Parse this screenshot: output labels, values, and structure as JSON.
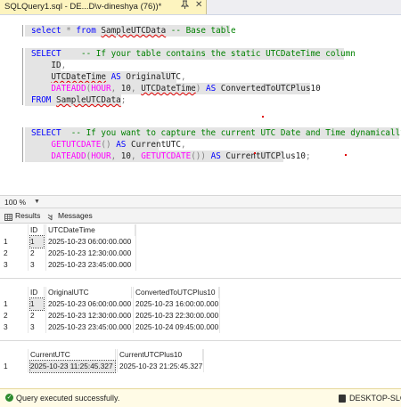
{
  "tab": {
    "title": "SQLQuery1.sql - DE...D\\v-dineshya (76))*",
    "pin_icon": "pin-icon",
    "close_glyph": "✕"
  },
  "editor": {
    "lines": [
      [
        {
          "t": "select",
          "c": "kw"
        },
        {
          "t": " ",
          "c": ""
        },
        {
          "t": "*",
          "c": "gr"
        },
        {
          "t": " ",
          "c": ""
        },
        {
          "t": "from",
          "c": "kw"
        },
        {
          "t": " ",
          "c": ""
        },
        {
          "t": "SampleUTCData",
          "c": "id-err"
        },
        {
          "t": " -- Base table",
          "c": "cm"
        }
      ],
      [],
      [
        {
          "t": "SELECT",
          "c": "kw"
        },
        {
          "t": "    -- If your table contains the static UTCDateTime column",
          "c": "cm"
        }
      ],
      [
        {
          "t": "    ID",
          "c": ""
        },
        {
          "t": ",",
          "c": "gr"
        }
      ],
      [
        {
          "t": "    ",
          "c": ""
        },
        {
          "t": "UTCDateTime",
          "c": "id-err"
        },
        {
          "t": " ",
          "c": ""
        },
        {
          "t": "AS",
          "c": "kw"
        },
        {
          "t": " OriginalUTC",
          "c": ""
        },
        {
          "t": ",",
          "c": "gr"
        }
      ],
      [
        {
          "t": "    ",
          "c": ""
        },
        {
          "t": "DATEADD",
          "c": "fn"
        },
        {
          "t": "(",
          "c": "gr"
        },
        {
          "t": "HOUR",
          "c": "fn"
        },
        {
          "t": ",",
          "c": "gr"
        },
        {
          "t": " 10",
          "c": ""
        },
        {
          "t": ",",
          "c": "gr"
        },
        {
          "t": " ",
          "c": ""
        },
        {
          "t": "UTCDateTime",
          "c": "id-err"
        },
        {
          "t": ")",
          "c": "gr"
        },
        {
          "t": " ",
          "c": ""
        },
        {
          "t": "AS",
          "c": "kw"
        },
        {
          "t": " ConvertedToUTCPlus10",
          "c": ""
        }
      ],
      [
        {
          "t": "FROM",
          "c": "kw"
        },
        {
          "t": " ",
          "c": ""
        },
        {
          "t": "SampleUTCData",
          "c": "id-err"
        },
        {
          "t": ";",
          "c": "gr"
        }
      ],
      [],
      [],
      [
        {
          "t": "SELECT",
          "c": "kw"
        },
        {
          "t": "  -- If you want to capture the current UTC Date and Time dynamically",
          "c": "cm"
        }
      ],
      [
        {
          "t": "    ",
          "c": ""
        },
        {
          "t": "GETUTCDATE",
          "c": "fn"
        },
        {
          "t": "()",
          "c": "gr"
        },
        {
          "t": " ",
          "c": ""
        },
        {
          "t": "AS",
          "c": "kw"
        },
        {
          "t": " CurrentUTC",
          "c": ""
        },
        {
          "t": ",",
          "c": "gr"
        }
      ],
      [
        {
          "t": "    ",
          "c": ""
        },
        {
          "t": "DATEADD",
          "c": "fn"
        },
        {
          "t": "(",
          "c": "gr"
        },
        {
          "t": "HOUR",
          "c": "fn"
        },
        {
          "t": ",",
          "c": "gr"
        },
        {
          "t": " 10",
          "c": ""
        },
        {
          "t": ",",
          "c": "gr"
        },
        {
          "t": " ",
          "c": ""
        },
        {
          "t": "GETUTCDATE",
          "c": "fn"
        },
        {
          "t": "())",
          "c": "gr"
        },
        {
          "t": " ",
          "c": ""
        },
        {
          "t": "AS",
          "c": "kw"
        },
        {
          "t": " CurrentUTCPlus10",
          "c": ""
        },
        {
          "t": ";",
          "c": "gr"
        }
      ]
    ]
  },
  "zoom": {
    "value": "100 %"
  },
  "results_tabs": [
    {
      "label": "Results",
      "icon": "grid-icon"
    },
    {
      "label": "Messages",
      "icon": "messages-icon"
    }
  ],
  "grids": [
    {
      "columns": [
        "ID",
        "UTCDateTime"
      ],
      "rows": [
        [
          "1",
          "1",
          "2025-10-23 06:00:00.000"
        ],
        [
          "2",
          "2",
          "2025-10-23 12:30:00.000"
        ],
        [
          "3",
          "3",
          "2025-10-23 23:45:00.000"
        ]
      ]
    },
    {
      "columns": [
        "ID",
        "OriginalUTC",
        "ConvertedToUTCPlus10"
      ],
      "rows": [
        [
          "1",
          "1",
          "2025-10-23 06:00:00.000",
          "2025-10-23 16:00:00.000"
        ],
        [
          "2",
          "2",
          "2025-10-23 12:30:00.000",
          "2025-10-23 22:30:00.000"
        ],
        [
          "3",
          "3",
          "2025-10-23 23:45:00.000",
          "2025-10-24 09:45:00.000"
        ]
      ]
    },
    {
      "columns": [
        "CurrentUTC",
        "CurrentUTCPlus10"
      ],
      "rows": [
        [
          "1",
          "2025-10-23 11:25:45.327",
          "2025-10-23 21:25:45.327"
        ]
      ]
    }
  ],
  "status": {
    "message": "Query executed successfully.",
    "server": "DESKTOP-SLO",
    "success_color": "#2e8b2e"
  }
}
